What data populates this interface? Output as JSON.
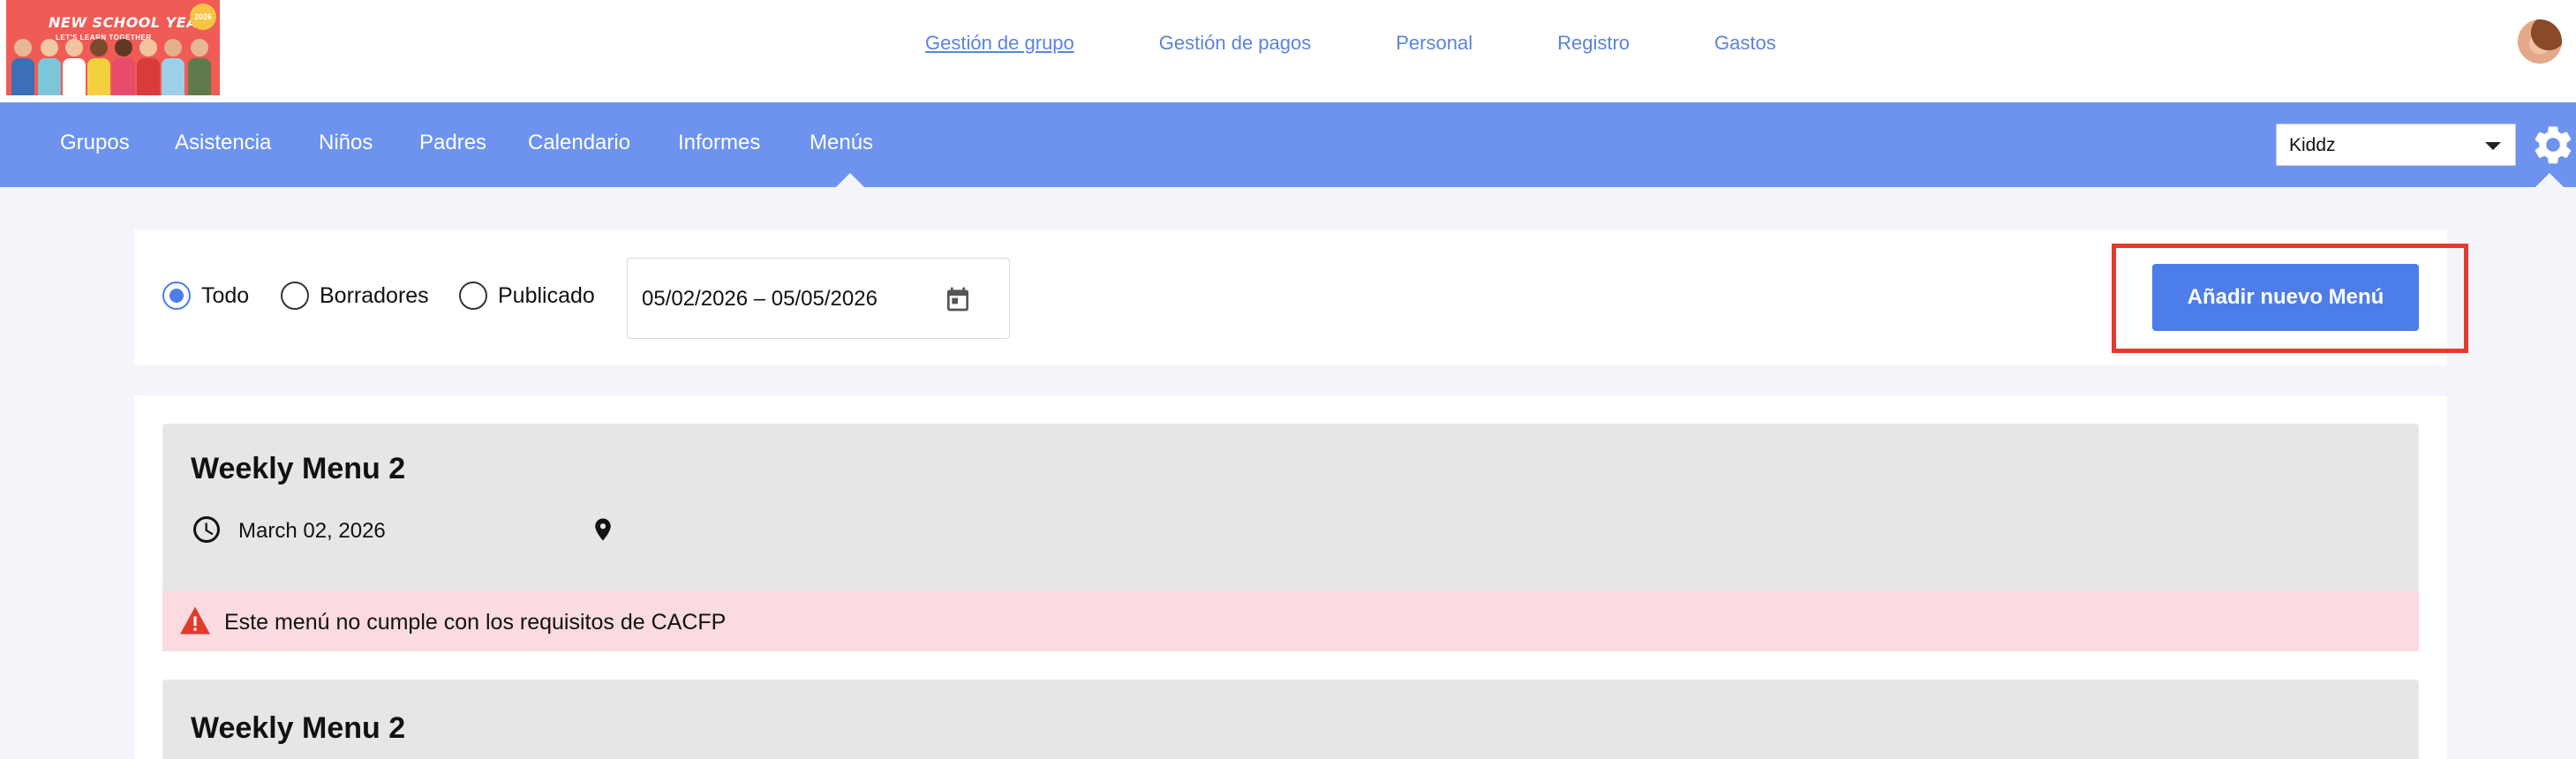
{
  "logo": {
    "title": "NEW SCHOOL YEAR",
    "subtitle": "LET'S LEARN TOGETHER",
    "badge": "2026"
  },
  "top_nav": {
    "items": [
      "Gestión de grupo",
      "Gestión de pagos",
      "Personal",
      "Registro",
      "Gastos"
    ],
    "active": "Gestión de grupo",
    "link_color": "#5b84d8"
  },
  "main_nav": {
    "background": "#6d93ef",
    "items": [
      "Grupos",
      "Asistencia",
      "Niños",
      "Padres",
      "Calendario",
      "Informes",
      "Menús"
    ],
    "active": "Menús"
  },
  "school_select": {
    "selected": "Kiddz"
  },
  "settings_icon": "gear-icon",
  "filters": {
    "options": [
      {
        "label": "Todo",
        "checked": true
      },
      {
        "label": "Borradores",
        "checked": false
      },
      {
        "label": "Publicado",
        "checked": false
      }
    ],
    "date_range": "05/02/2026 – 05/05/2026",
    "calendar_icon": "calendar-icon"
  },
  "actions": {
    "add_menu_label": "Añadir nuevo Menú",
    "accent": "#4d7de8",
    "highlight_color": "#e23b2e"
  },
  "menus": [
    {
      "title": "Weekly Menu 2",
      "date": "March 02, 2026",
      "warning": "Este menú no cumple con los requisitos de CACFP"
    },
    {
      "title": "Weekly Menu 2"
    }
  ]
}
